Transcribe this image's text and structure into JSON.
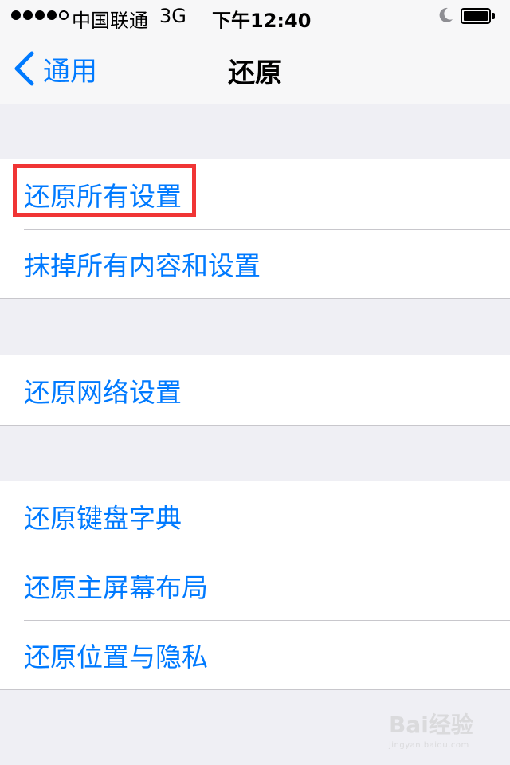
{
  "status_bar": {
    "carrier": "中国联通",
    "network": "3G",
    "time": "下午12:40",
    "signal_bars_filled": 4,
    "signal_bars_total": 5,
    "icons": [
      "signal-dots-icon",
      "moon-icon",
      "battery-icon"
    ]
  },
  "nav": {
    "back_label": "通用",
    "title": "还原"
  },
  "groups": [
    {
      "items": [
        "还原所有设置",
        "抹掉所有内容和设置"
      ]
    },
    {
      "items": [
        "还原网络设置"
      ]
    },
    {
      "items": [
        "还原键盘字典",
        "还原主屏幕布局",
        "还原位置与隐私"
      ]
    }
  ],
  "colors": {
    "accent": "#007aff",
    "background": "#efeff4",
    "highlight_box": "#f03535"
  },
  "highlighted_item": "还原所有设置",
  "watermark": {
    "text": "Bai经验",
    "subtext": "jingyan.baidu.com"
  }
}
